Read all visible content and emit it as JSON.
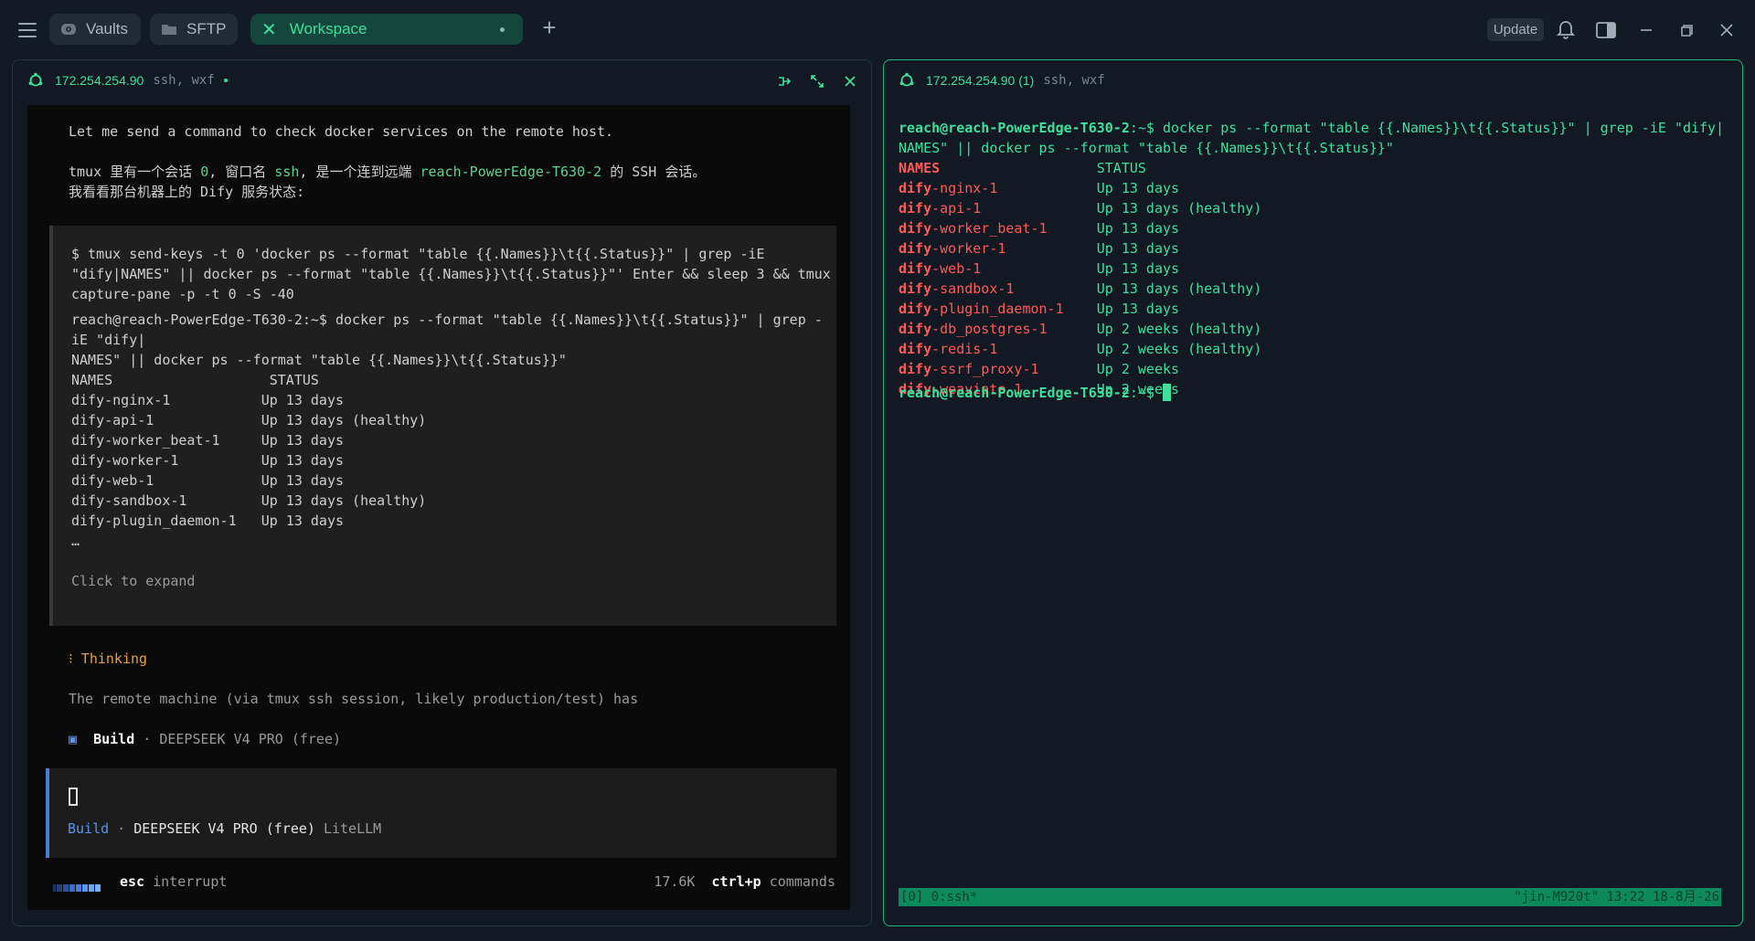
{
  "topbar": {
    "tabs": [
      {
        "label": "Vaults",
        "icon": "vault-icon"
      },
      {
        "label": "SFTP",
        "icon": "folder-icon"
      },
      {
        "label": "Workspace",
        "icon": "close-icon"
      }
    ],
    "update_label": "Update"
  },
  "left_pane": {
    "host": "172.254.254.90",
    "sub": "ssh, wxf",
    "lines": {
      "intro": "Let me send a command to check docker services on the remote host.",
      "zh1_a": "tmux 里有一个会话 ",
      "zh1_b": "0",
      "zh1_c": ", 窗口名 ",
      "zh1_d": "ssh",
      "zh1_e": ", 是一个连到远端 ",
      "zh1_f": "reach-PowerEdge-T630-2",
      "zh1_g": " 的 SSH 会话。",
      "zh2": "我看看那台机器上的 Dify 服务状态:"
    },
    "tool_block": {
      "cmd1": "$ tmux send-keys -t 0 'docker ps --format \"table {{.Names}}\\t{{.Status}}\" | grep -iE",
      "cmd2": "\"dify|NAMES\" || docker ps --format \"table {{.Names}}\\t{{.Status}}\"' Enter && sleep 3 && tmux",
      "cmd3": "capture-pane -p -t 0 -S -40",
      "out1": "reach@reach-PowerEdge-T630-2:~$ docker ps --format \"table {{.Names}}\\t{{.Status}}\" | grep -",
      "out2": "iE \"dify|",
      "out3": "NAMES\" || docker ps --format \"table {{.Names}}\\t{{.Status}}\"",
      "header": "NAMES                   STATUS",
      "rows": [
        "dify-nginx-1           Up 13 days",
        "dify-api-1             Up 13 days (healthy)",
        "dify-worker_beat-1     Up 13 days",
        "dify-worker-1          Up 13 days",
        "dify-web-1             Up 13 days",
        "dify-sandbox-1         Up 13 days (healthy)",
        "dify-plugin_daemon-1   Up 13 days"
      ],
      "ellipsis": "…",
      "expand": "Click to expand"
    },
    "thinking": "⁝ Thinking",
    "thinking_text": "The remote machine (via tmux ssh session, likely production/test) has",
    "build_line": {
      "icon": "▣",
      "label": "Build",
      "sep": " · ",
      "model": "DEEPSEEK V4 PRO (free)"
    },
    "input_box": {
      "label": "Build",
      "sep": " · ",
      "model": "DEEPSEEK V4 PRO (free)",
      "provider": "LiteLLM"
    },
    "footer": {
      "esc": "esc",
      "esc_action": "interrupt",
      "tokens": "17.6K",
      "shortcut": "ctrl+p",
      "shortcut_action": "commands"
    }
  },
  "right_pane": {
    "host": "172.254.254.90 (1)",
    "sub": "ssh, wxf",
    "prompt": "reach@reach-PowerEdge-T630-2",
    "prompt_suffix": ":~$",
    "cmd1": " docker ps --format \"table {{.Names}}\\t{{.Status}}\" | grep -iE \"dify|",
    "cmd2": "NAMES\" || docker ps --format \"table {{.Names}}\\t{{.Status}}\"",
    "header_names": "NAMES",
    "header_status": "STATUS",
    "prefix": "dify",
    "rows": [
      {
        "suffix": "-nginx-1",
        "pad": "            ",
        "status": "Up 13 days"
      },
      {
        "suffix": "-api-1",
        "pad": "              ",
        "status": "Up 13 days (healthy)"
      },
      {
        "suffix": "-worker_beat-1",
        "pad": "      ",
        "status": "Up 13 days"
      },
      {
        "suffix": "-worker-1",
        "pad": "           ",
        "status": "Up 13 days"
      },
      {
        "suffix": "-web-1",
        "pad": "              ",
        "status": "Up 13 days"
      },
      {
        "suffix": "-sandbox-1",
        "pad": "          ",
        "status": "Up 13 days (healthy)"
      },
      {
        "suffix": "-plugin_daemon-1",
        "pad": "    ",
        "status": "Up 13 days"
      },
      {
        "suffix": "-db_postgres-1",
        "pad": "      ",
        "status": "Up 2 weeks (healthy)"
      },
      {
        "suffix": "-redis-1",
        "pad": "            ",
        "status": "Up 2 weeks (healthy)"
      },
      {
        "suffix": "-ssrf_proxy-1",
        "pad": "       ",
        "status": "Up 2 weeks"
      },
      {
        "suffix": "-weaviate-1",
        "pad": "         ",
        "status": "Up 2 weeks"
      }
    ],
    "tmux_left": "[0] 0:ssh*",
    "tmux_right": "\"jin-M920t\" 13:22 18-8月-26"
  },
  "colors": {
    "accent": "#3fdf9c",
    "bg": "#141a24",
    "red": "#ff5a5a",
    "build_blue": "#5b93ee",
    "thinking": "#e5a042"
  }
}
